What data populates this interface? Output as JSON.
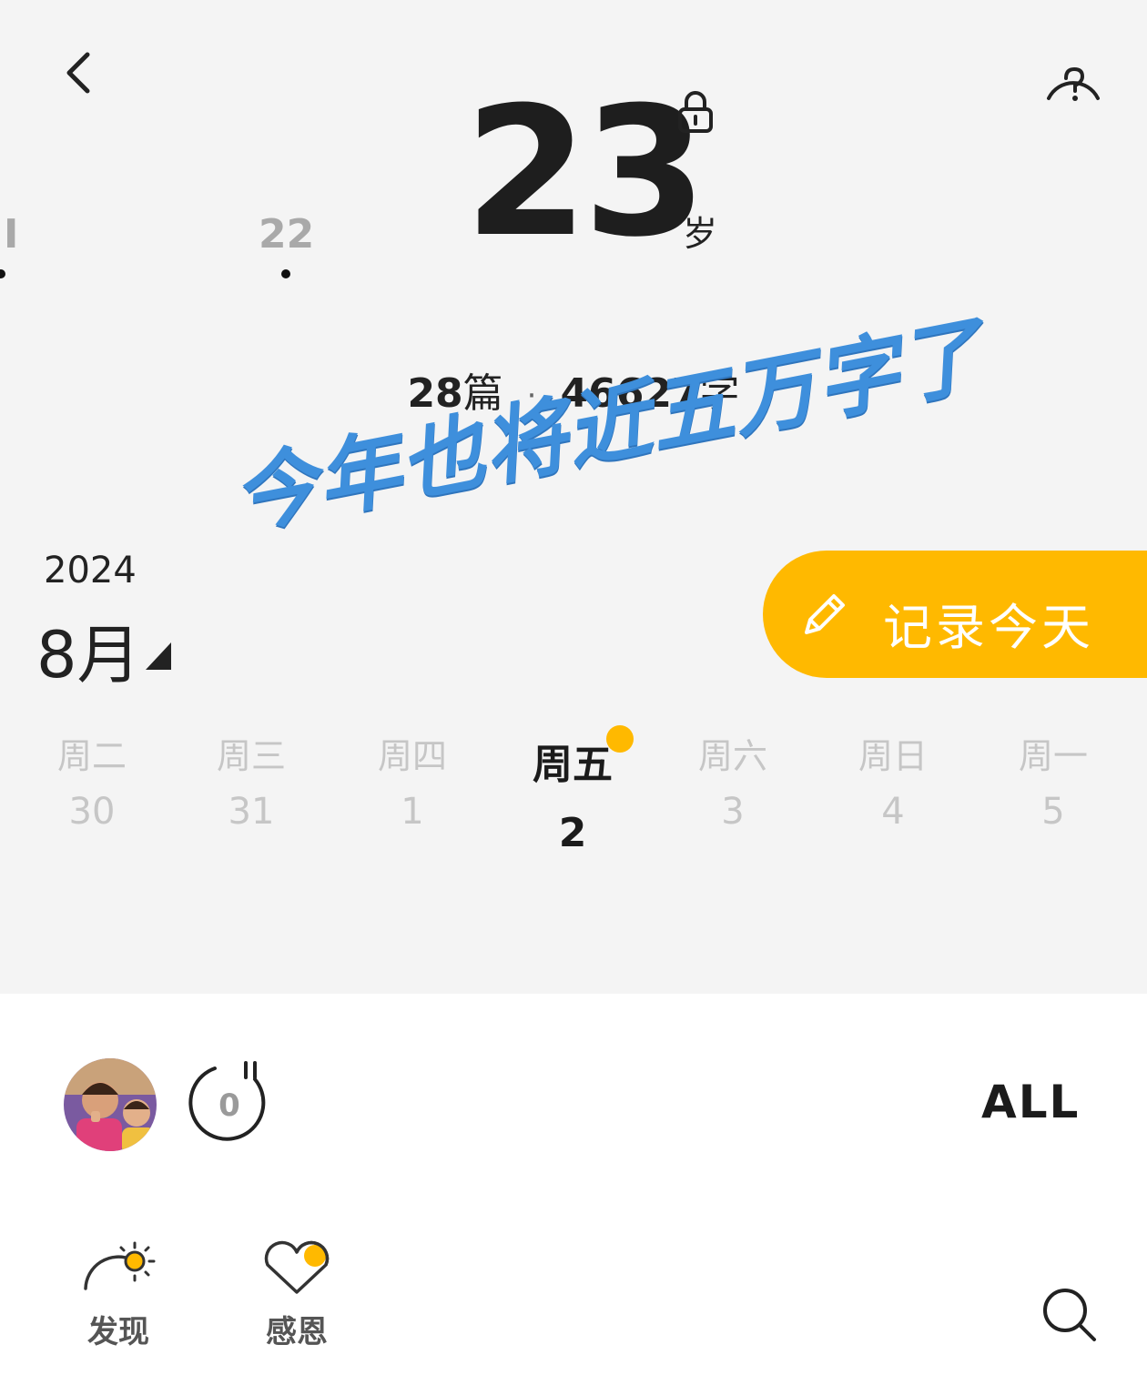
{
  "header": {
    "age_value": "23",
    "age_unit": "岁",
    "prev_ages": [
      "I",
      "22"
    ]
  },
  "stats": {
    "posts_count": "28",
    "posts_unit": "篇",
    "separator": "·",
    "words_count": "46627",
    "words_unit": "字"
  },
  "overlay": {
    "annotation_text": "今年也将近五万字了"
  },
  "calendar": {
    "year": "2024",
    "month": "8月",
    "record_button_label": "记录今天",
    "week": [
      {
        "weekday": "周二",
        "date": "30"
      },
      {
        "weekday": "周三",
        "date": "31"
      },
      {
        "weekday": "周四",
        "date": "1"
      },
      {
        "weekday": "周五",
        "date": "2"
      },
      {
        "weekday": "周六",
        "date": "3"
      },
      {
        "weekday": "周日",
        "date": "4"
      },
      {
        "weekday": "周一",
        "date": "5"
      }
    ],
    "selected_index": 3
  },
  "toolbar": {
    "timer_value": "0",
    "filter_label": "ALL"
  },
  "bottom_nav": {
    "discover_label": "发现",
    "gratitude_label": "感恩"
  },
  "colors": {
    "accent": "#ffb900",
    "overlay_blue": "#3e8fdc",
    "background": "#f4f4f4"
  },
  "icons": [
    "back-arrow-icon",
    "help-icon",
    "lock-icon",
    "caret-icon",
    "pencil-icon",
    "timer-icon",
    "sunrise-icon",
    "heart-icon",
    "search-icon"
  ]
}
